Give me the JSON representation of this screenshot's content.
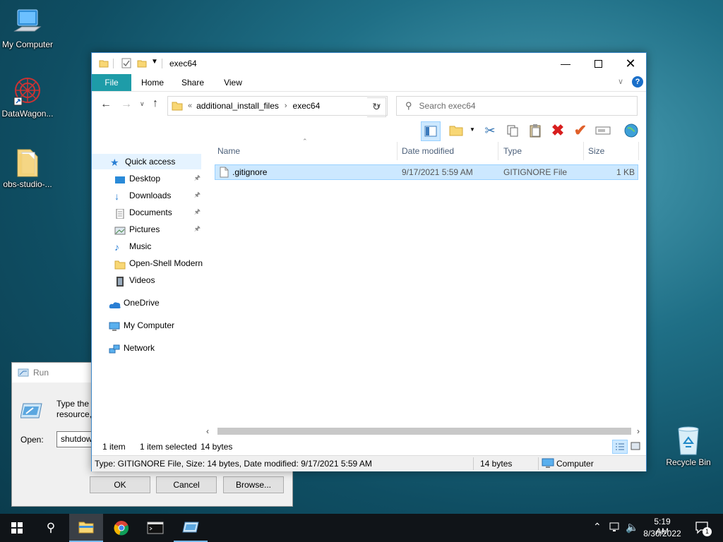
{
  "desktop": {
    "icons": [
      {
        "label": "My Computer"
      },
      {
        "label": "DataWagon..."
      },
      {
        "label": "obs-studio-..."
      },
      {
        "label": "Recycle Bin"
      }
    ]
  },
  "run_dialog": {
    "title": "Run",
    "description_line1": "Type the n",
    "description_line2": "resource,",
    "open_label": "Open:",
    "open_value": "shutdow",
    "ok_label": "OK",
    "cancel_label": "Cancel",
    "browse_label": "Browse..."
  },
  "explorer": {
    "title": "exec64",
    "ribbon_tabs": [
      "File",
      "Home",
      "Share",
      "View"
    ],
    "breadcrumb": {
      "overflow": "«",
      "parts": [
        "additional_install_files",
        "exec64"
      ]
    },
    "search_placeholder": "Search exec64",
    "nav": {
      "quick_access": "Quick access",
      "items": [
        {
          "label": "Desktop",
          "pinned": true
        },
        {
          "label": "Downloads",
          "pinned": true
        },
        {
          "label": "Documents",
          "pinned": true
        },
        {
          "label": "Pictures",
          "pinned": true
        },
        {
          "label": "Music",
          "pinned": false
        },
        {
          "label": "Open-Shell Modern",
          "pinned": false
        },
        {
          "label": "Videos",
          "pinned": false
        }
      ],
      "onedrive": "OneDrive",
      "my_computer": "My Computer",
      "network": "Network"
    },
    "columns": [
      "Name",
      "Date modified",
      "Type",
      "Size"
    ],
    "files": [
      {
        "name": ".gitignore",
        "date": "9/17/2021 5:59 AM",
        "type": "GITIGNORE File",
        "size": "1 KB"
      }
    ],
    "status": {
      "count": "1 item",
      "selected": "1 item selected",
      "bytes": "14 bytes"
    },
    "details": {
      "text": "Type: GITIGNORE File, Size: 14 bytes, Date modified: 9/17/2021 5:59 AM",
      "size": "14 bytes",
      "location": "Computer"
    }
  },
  "taskbar": {
    "time": "5:19 AM",
    "date": "8/30/2022",
    "notification_count": "1"
  },
  "colors": {
    "accent": "#0078d7",
    "file_tab": "#1e9ca8",
    "selection": "#cce8ff",
    "folder": "#f8d775"
  }
}
